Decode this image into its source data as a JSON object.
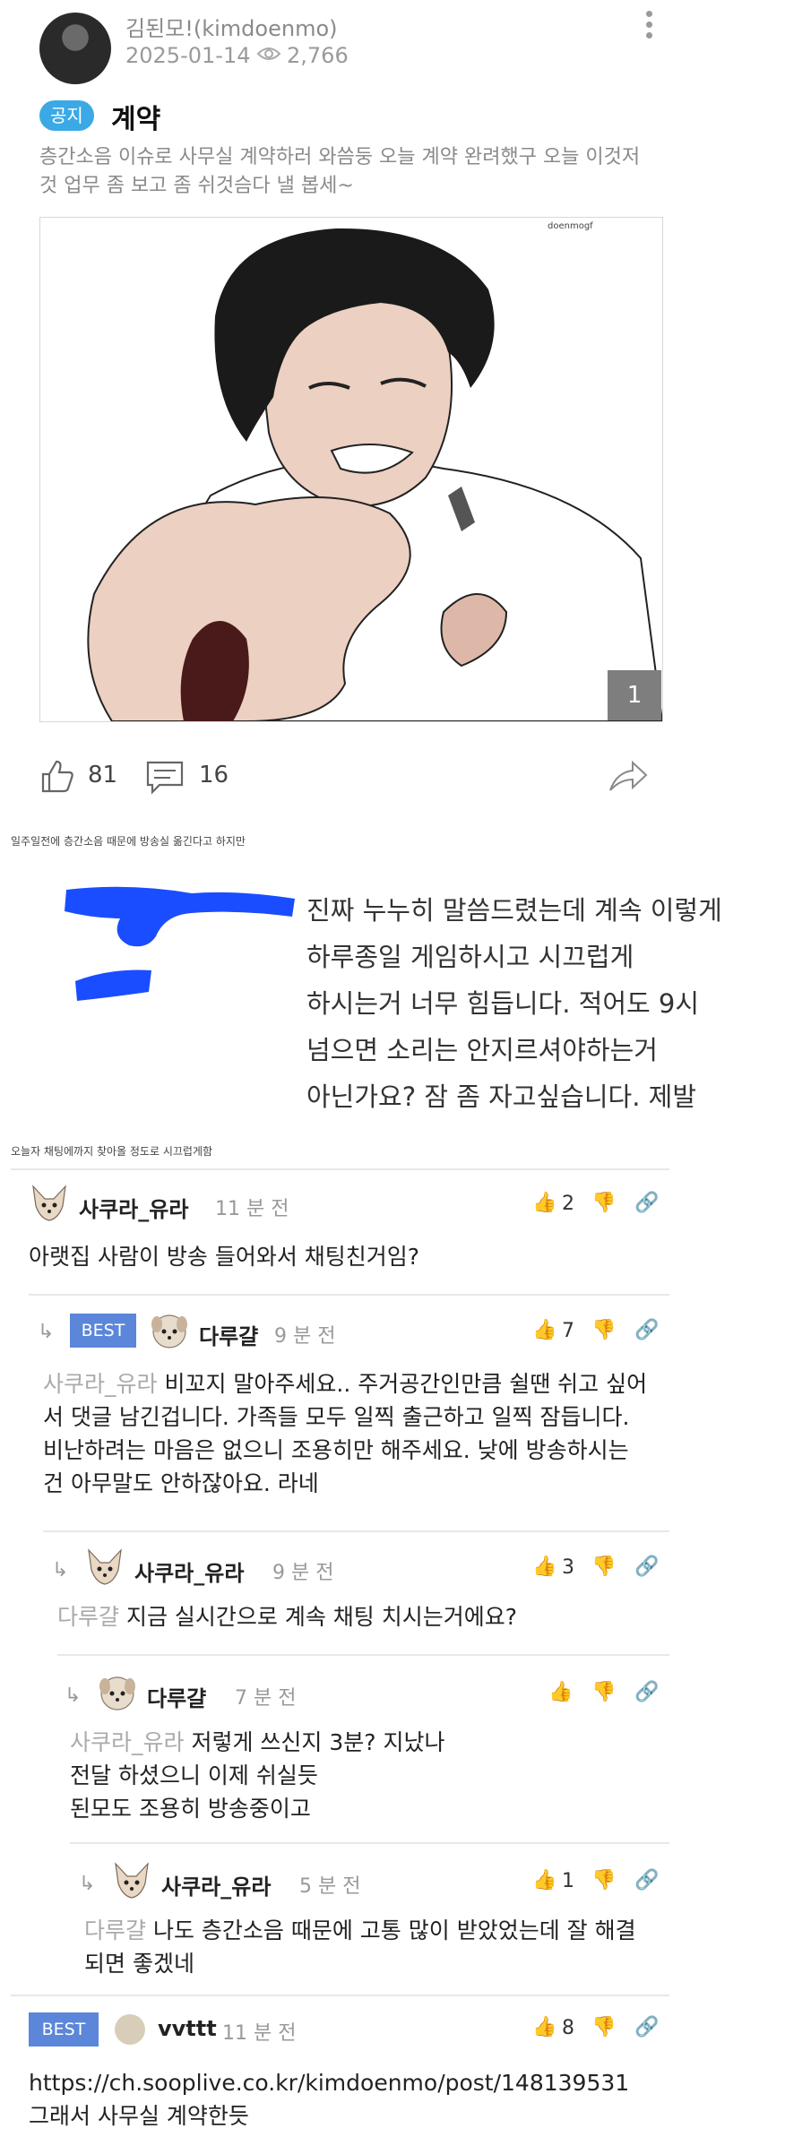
{
  "post": {
    "author": "김된모!(kimdoenmo)",
    "date": "2025-01-14",
    "views": "2,766",
    "badge": "공지",
    "title": "계약",
    "body": "층간소음 이슈로 사무실 계약하러 와씀둥 오늘 계약 완려했구 오늘 이것저것 업무 좀 보고 좀 쉬것슴다 낼 봅세~",
    "image_watermark": "doenmogf",
    "image_counter": "1",
    "likes": "81",
    "comments": "16"
  },
  "caption1": "일주일전에 층간소음 때문에 방송실 옮긴다고 하지만",
  "message": {
    "lines": [
      "진짜 누누히 말씀드렸는데 계속 이렇게",
      "하루종일 게임하시고 시끄럽게",
      "하시는거 너무 힘듭니다. 적어도 9시",
      "넘으면 소리는 안지르셔야하는거",
      "아닌가요? 잠 좀 자고싶습니다. 제발"
    ]
  },
  "caption2": "오늘자 채팅에까지 찾아올 정도로 시끄럽게함",
  "comments": [
    {
      "name": "사쿠라_유라",
      "time": "11 분 전",
      "likes": "2",
      "body": "아랫집 사람이 방송 들어와서 채팅친거임?"
    },
    {
      "best": "BEST",
      "name": "다루걀",
      "time": "9 분 전",
      "likes": "7",
      "mention": "사쿠라_유라",
      "body_lines": [
        "비꼬지 말아주세요.. 주거공간인만큼 쉴땐 쉬고 싶어",
        "서 댓글 남긴겁니다. 가족들 모두 일찍 출근하고 일찍 잠듭니다.",
        "비난하려는 마음은 없으니 조용히만 해주세요. 낮에 방송하시는",
        "건 아무말도 안하잖아요. 라네"
      ]
    },
    {
      "name": "사쿠라_유라",
      "time": "9 분 전",
      "likes": "3",
      "mention": "다루걀",
      "body": "지금 실시간으로 계속 채팅 치시는거에요?"
    },
    {
      "name": "다루걀",
      "time": "7 분 전",
      "likes": "",
      "mention": "사쿠라_유라",
      "body_lines": [
        "저렇게 쓰신지 3분? 지났나",
        "전달 하셨으니 이제 쉬실듯",
        "된모도 조용히 방송중이고"
      ]
    },
    {
      "name": "사쿠라_유라",
      "time": "5 분 전",
      "likes": "1",
      "mention": "다루걀",
      "body_lines": [
        "나도 층간소음 때문에 고통 많이 받았었는데 잘 해결",
        "되면 좋겠네"
      ]
    },
    {
      "best": "BEST",
      "name": "vvttt",
      "time": "11 분 전",
      "likes": "8",
      "body_lines": [
        "https://ch.sooplive.co.kr/kimdoenmo/post/148139531",
        "그래서 사무실 계약한듯"
      ]
    }
  ]
}
